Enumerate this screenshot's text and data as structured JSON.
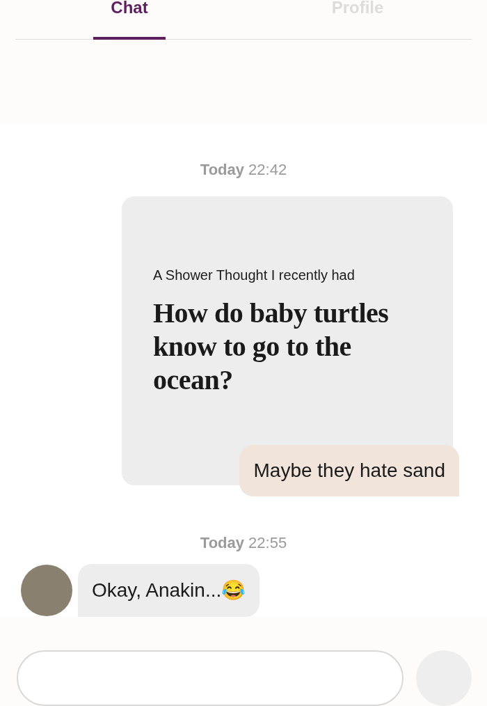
{
  "tabs": [
    {
      "label": "Chat",
      "selected": true
    },
    {
      "label": "Profile",
      "selected": false
    }
  ],
  "messages": [
    {
      "kind": "timestamp",
      "text": "**Today** 22:42"
    },
    {
      "kind": "shared_card",
      "caption": "A Shower Thought I recently had",
      "title": "How do baby turtles know to go to the ocean?",
      "reply": "Maybe they hate sand"
    },
    {
      "kind": "timestamp",
      "text": "**Today** 22:55"
    },
    {
      "kind": "incoming",
      "text": "Okay, Anakin...😂"
    }
  ]
}
